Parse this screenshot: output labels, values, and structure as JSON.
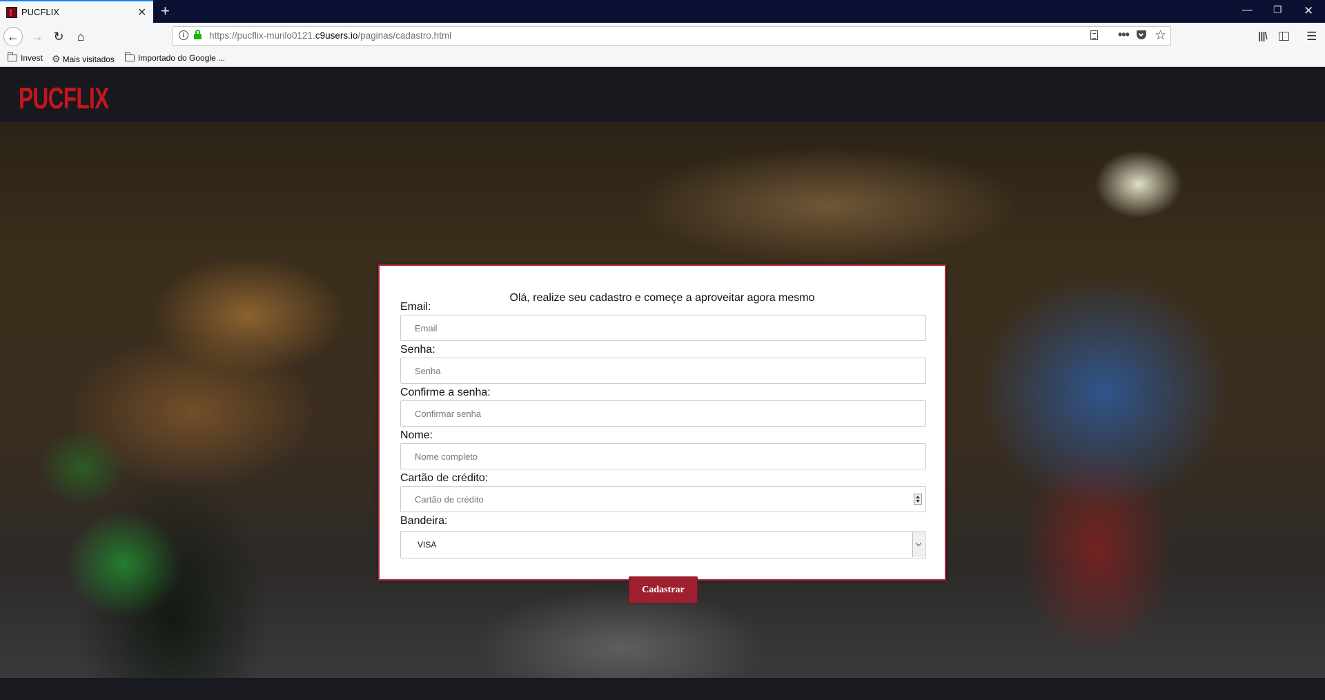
{
  "browser": {
    "tab_title": "PUCFLIX",
    "new_tab_symbol": "+",
    "url_prefix": "https://pucflix-murilo0121.",
    "url_host": "c9users.io",
    "url_path": "/paginas/cadastro.html",
    "bookmarks": [
      "Invest",
      "Mais visitados",
      "Importado do Google ..."
    ]
  },
  "site": {
    "logo": "PUCFLIX"
  },
  "form": {
    "title": "Olá, realize seu cadastro e começe a aproveitar agora mesmo",
    "email_label": "Email:",
    "email_placeholder": "Email",
    "password_label": "Senha:",
    "password_placeholder": "Senha",
    "confirm_label": "Confirme a senha:",
    "confirm_placeholder": "Confirmar senha",
    "name_label": "Nome:",
    "name_placeholder": "Nome completo",
    "card_label": "Cartão de crédito:",
    "card_placeholder": "Cartão de crédito",
    "brand_label": "Bandeira:",
    "brand_value": "VISA",
    "submit_label": "Cadastrar"
  }
}
